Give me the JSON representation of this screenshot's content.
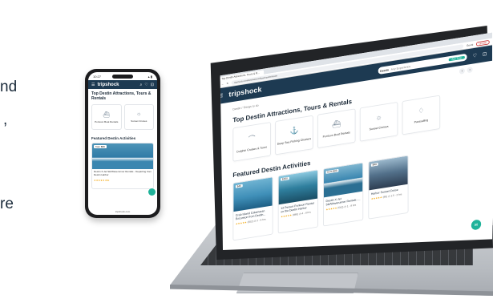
{
  "left_text": [
    "nd",
    ",",
    "re"
  ],
  "phone": {
    "time": "10:27",
    "status_icons": "▴ ▮",
    "logo": "tripshock",
    "title": "Top Destin Attractions, Tours & Rentals",
    "categories": [
      {
        "icon": "jetski-icon",
        "label": "Pontoon Boat Rentals"
      },
      {
        "icon": "sun-icon",
        "label": "Sunset Cruises"
      }
    ],
    "featured_title": "Featured Destin Activities",
    "card": {
      "price": "from $99",
      "title": "Destin X-Jet Ski/Waverunner Rentals - Departing from Destin Harbor",
      "stars": "★★★★★ 882"
    },
    "url": "tripshock.com"
  },
  "browser": {
    "tab_label": "Top Destin Attractions, Tours & R...",
    "url": "tripshock.com/destinations/fl/panhandle/destin",
    "guest_label": "Guest",
    "update_label": "Update"
  },
  "site": {
    "logo": "tripshock",
    "search_label": "Destin",
    "search_placeholder": "Any Experience",
    "search_button": "Any Time",
    "breadcrumb": "Destin / Things to do",
    "section_title": "Top Destin Attractions, Tours & Rentals",
    "categories": [
      {
        "icon": "dolphin-icon",
        "label": "Dolphin Cruises & Tours"
      },
      {
        "icon": "fishing-icon",
        "label": "Deep Sea Fishing Charters"
      },
      {
        "icon": "boat-icon",
        "label": "Pontoon Boat Rentals"
      },
      {
        "icon": "sun-icon",
        "label": "Sunset Cruises"
      },
      {
        "icon": "parasail-icon",
        "label": "Parasailing"
      }
    ],
    "featured_title": "Featured Destin Activities",
    "featured": [
      {
        "price": "$46",
        "title": "Crab Island Catamaran Excursion from Destin...",
        "stars": "★★★★★",
        "reviews": "(352)",
        "duration": "2 - 4 hrs"
      },
      {
        "price": "$550",
        "title": "12 Person Pontoon Rental on the Destin Harbor",
        "stars": "★★★★★",
        "reviews": "(880)",
        "duration": "4 - 8 hrs"
      },
      {
        "price": "from $99",
        "title": "Destin X-Jet Ski/Waverunner Rentals -...",
        "stars": "★★★★★",
        "reviews": "(562)",
        "duration": "1 - 8 hrs"
      },
      {
        "price": "$48",
        "title": "Harbor Sunset Cruise",
        "stars": "★★★★★",
        "reviews": "(88)",
        "duration": "1.5 - 2 hrs"
      }
    ]
  }
}
